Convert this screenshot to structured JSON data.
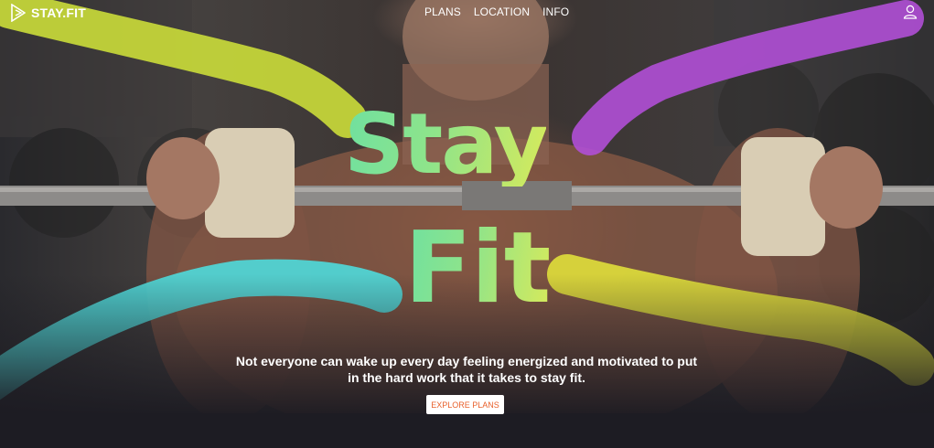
{
  "brand": {
    "name": "STAY.FIT"
  },
  "nav": {
    "items": [
      "PLANS",
      "LOCATION",
      "INFO"
    ]
  },
  "hero": {
    "title_line1": "Stay",
    "title_line2": "Fit",
    "tagline": "Not everyone can wake up every day feeling energized and motivated to put in the hard work that it takes to stay fit.",
    "cta_label": "EXPLORE PLANS"
  },
  "colors": {
    "accent": "#e8612c",
    "title_gradient_start": "#6fe0a0",
    "title_gradient_end": "#d7ea5b",
    "stroke_lime": "#c8d93a",
    "stroke_purple": "#b04fd6",
    "stroke_cyan": "#4fd8d8",
    "stroke_yellow": "#e2e23a"
  },
  "icons": {
    "logo": "play-triangle-logo-icon",
    "user": "user-icon"
  }
}
